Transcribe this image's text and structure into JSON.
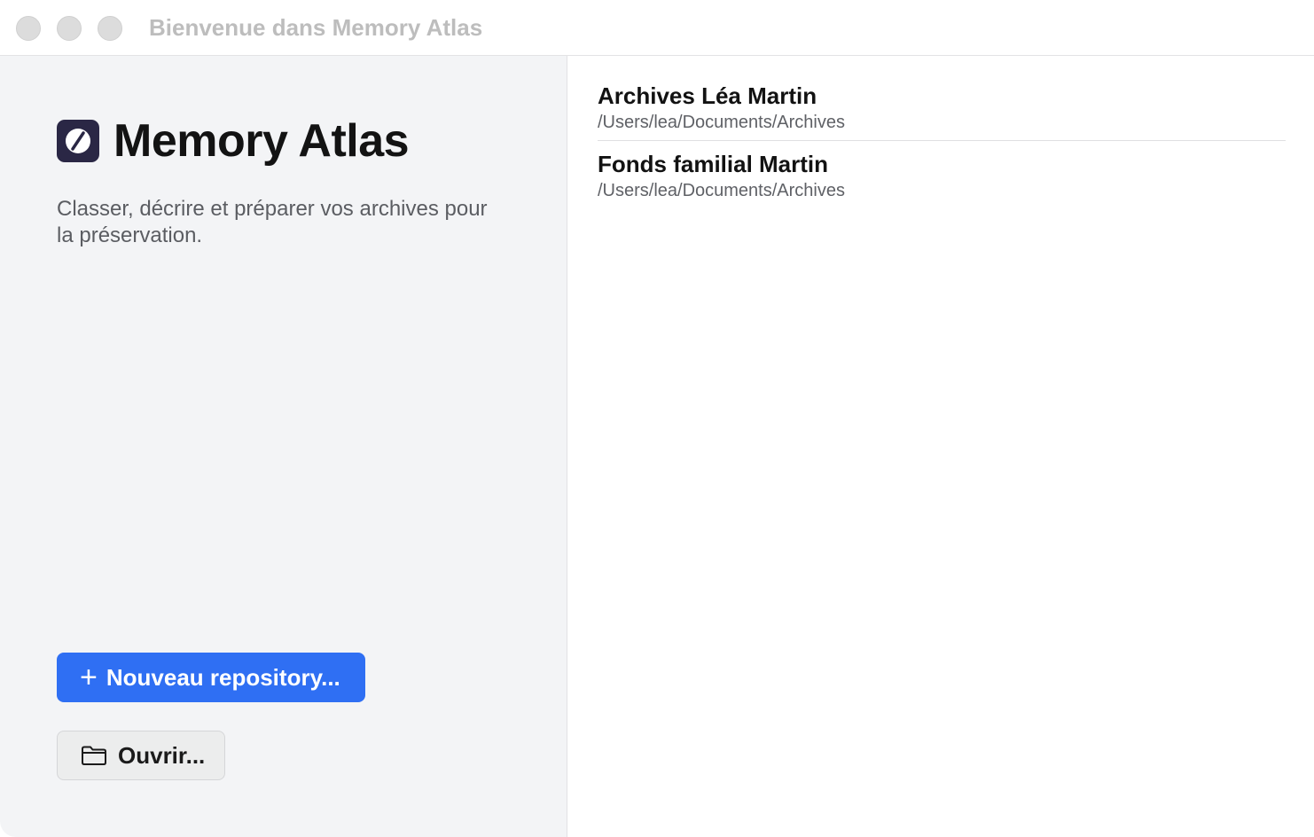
{
  "window": {
    "title": "Bienvenue dans Memory Atlas"
  },
  "sidebar": {
    "app_name": "Memory Atlas",
    "logo_icon": "slash-circle-icon",
    "tagline": "Classer, décrire et préparer vos archives pour la préservation.",
    "new_button_icon": "plus-icon",
    "new_button_label": "Nouveau repository...",
    "open_button_icon": "folder-icon",
    "open_button_label": "Ouvrir..."
  },
  "recent": {
    "items": [
      {
        "name": "Archives Léa Martin",
        "path": "/Users/lea/Documents/Archives"
      },
      {
        "name": "Fonds familial Martin",
        "path": "/Users/lea/Documents/Archives"
      }
    ]
  },
  "colors": {
    "accent": "#2f6ff3",
    "sidebar_bg": "#f3f4f6",
    "logo_bg": "#2a2745"
  }
}
